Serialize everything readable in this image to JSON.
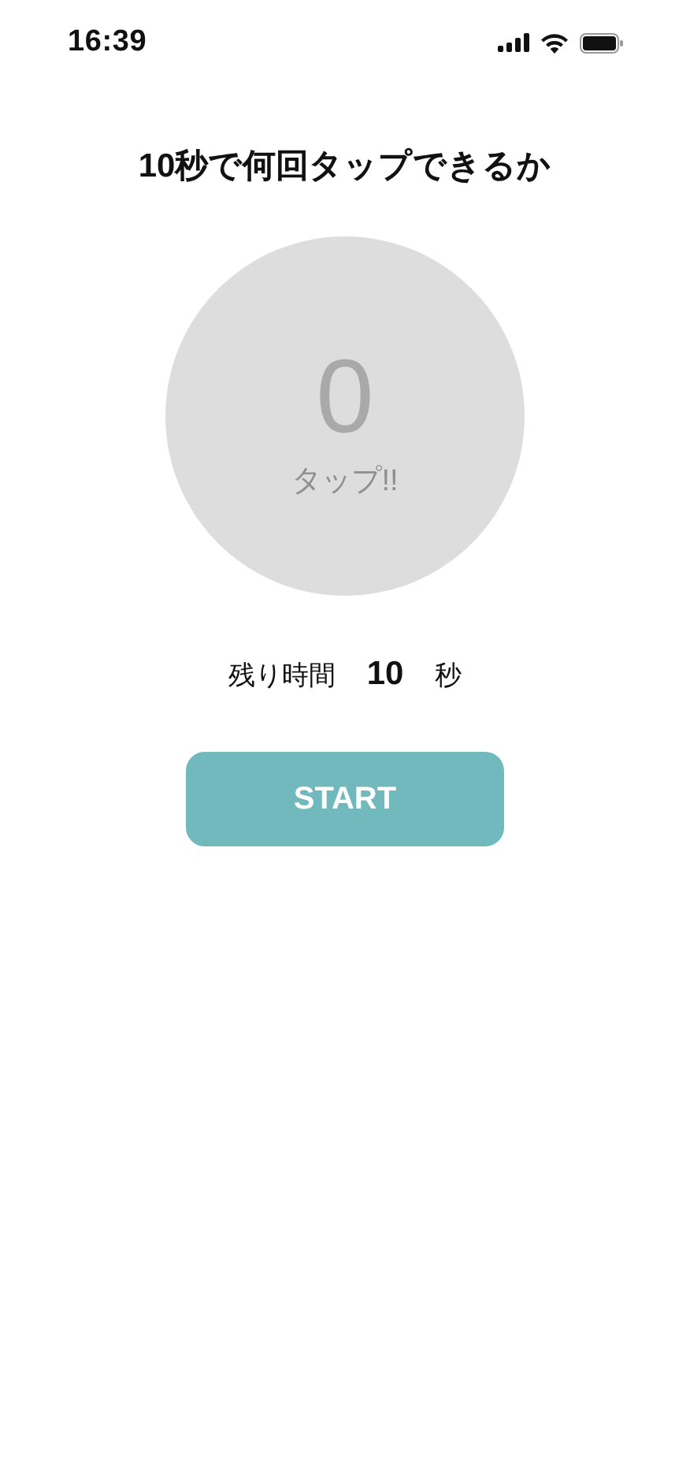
{
  "status_bar": {
    "time": "16:39"
  },
  "title": "10秒で何回タップできるか",
  "tap_circle": {
    "count": "0",
    "label": "タップ!!"
  },
  "timer": {
    "label": "残り時間",
    "value": "10",
    "unit": "秒"
  },
  "start_button": {
    "label": "START"
  }
}
